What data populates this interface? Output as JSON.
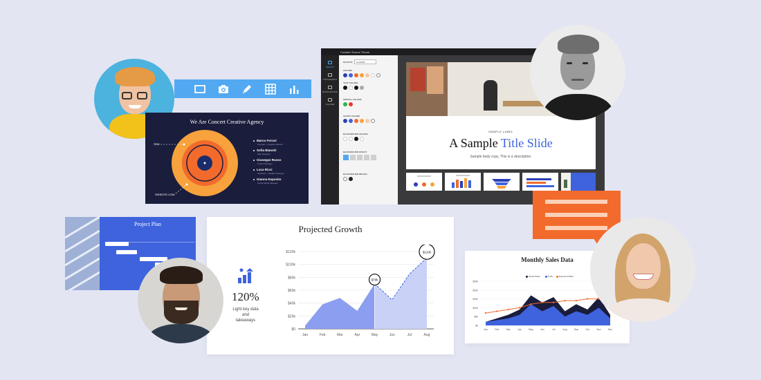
{
  "colors": {
    "background": "#e3e5f3",
    "toolbar": "#52a9f1",
    "navy": "#1a1d3b",
    "orange": "#f26a2c",
    "blue": "#3e63dd",
    "area_fill": "#8c9eef"
  },
  "toolbar": {
    "icons": [
      "slide-icon",
      "camera-icon",
      "pen-icon",
      "grid-icon",
      "bar-chart-icon"
    ]
  },
  "concert": {
    "title": "We Are Concert Creative Agency",
    "team": [
      {
        "name": "Marco Ferrari",
        "role": "Founder + Creative Director"
      },
      {
        "name": "Sofia Bianchi",
        "role": "Web Designer"
      },
      {
        "name": "Giuseppe Russo",
        "role": "Project Manager"
      },
      {
        "name": "Luca Ricci",
        "role": "Illustrator + Graphic Designer"
      },
      {
        "name": "Gianna Esposito",
        "role": "Social Media Manager"
      }
    ],
    "labels": {
      "left": "SEO",
      "bottom": "WEBSITE.COM"
    }
  },
  "editor": {
    "theme_title": "Creative Source Theme",
    "rail": [
      "DESIGN",
      "TYPOGRAPHY",
      "BACKGROUND",
      "FOOTER"
    ],
    "panel": {
      "palette_label": "PALETTE",
      "palette_value": "CLASSIC",
      "sections": [
        "COLORS",
        "TEXT COLORS",
        "SPECIAL COLORS",
        "CHART COLORS",
        "BACKGROUND COLORS",
        "BACKGROUND EFFECT",
        "BACKGROUND IMAGES"
      ]
    },
    "slide": {
      "label": "SAMPLE LABEL",
      "title_a": "A Sample ",
      "title_b": "Title Slide",
      "body": "Sample body copy. This is a description."
    }
  },
  "plan": {
    "title": "Project Plan"
  },
  "growth": {
    "title": "Projected Growth",
    "stat": "120%",
    "stat_caption": "Light key data and takeaways",
    "callouts": [
      "$70k",
      "$110k"
    ]
  },
  "sales": {
    "title": "Monthly Sales Data",
    "legend": [
      {
        "label": "Actual Sales",
        "color": "#1a1d3b"
      },
      {
        "label": "Profit",
        "color": "#3e63dd"
      },
      {
        "label": "Expected Sales",
        "color": "#f26a2c"
      }
    ]
  },
  "chart_data": [
    {
      "type": "area",
      "title": "Projected Growth",
      "categories": [
        "Jan",
        "Feb",
        "Mar",
        "Apr",
        "May",
        "Jun",
        "Jul",
        "Aug"
      ],
      "y_ticks": [
        "$0",
        "$20k",
        "$40k",
        "$60k",
        "$80k",
        "$100k",
        "$120k"
      ],
      "ylim": [
        0,
        120
      ],
      "series": [
        {
          "values": [
            5,
            38,
            48,
            28,
            70,
            45,
            85,
            110
          ]
        }
      ],
      "projected_from": "May"
    },
    {
      "type": "area",
      "title": "Monthly Sales Data",
      "categories": [
        "Jan",
        "Feb",
        "Mar",
        "Apr",
        "May",
        "Jun",
        "Jul",
        "Aug",
        "Sep",
        "Oct",
        "Nov",
        "Dec"
      ],
      "y_ticks": [
        "$0",
        "$5k",
        "$10k",
        "$15k",
        "$20k",
        "$25k"
      ],
      "ylim": [
        0,
        25
      ],
      "series": [
        {
          "name": "Actual Sales",
          "values": [
            2,
            4,
            6,
            9,
            17,
            13,
            16,
            8,
            12,
            9,
            16,
            6
          ]
        },
        {
          "name": "Profit",
          "values": [
            2,
            3,
            4,
            6,
            12,
            8,
            11,
            5,
            8,
            6,
            10,
            4
          ]
        },
        {
          "name": "Expected Sales",
          "values": [
            7,
            8,
            9,
            10,
            12,
            13,
            13,
            14,
            14,
            15,
            15,
            16
          ]
        }
      ]
    }
  ]
}
